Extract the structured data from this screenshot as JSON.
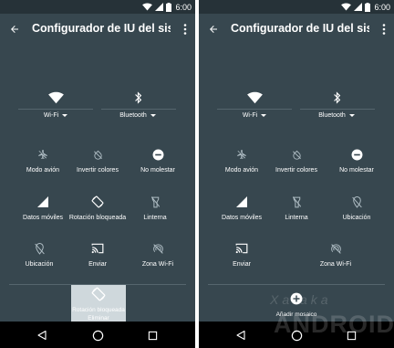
{
  "colors": {
    "background": "#37474f",
    "statusbar": "#263238",
    "navbar": "#000000",
    "text": "#ffffff",
    "drag_tile": "#cfd8dc"
  },
  "status": {
    "time": "6:00"
  },
  "left": {
    "title": "Configurador de IU del sist...",
    "top_tiles": [
      {
        "label": "Wi-Fi",
        "icon": "wifi-icon"
      },
      {
        "label": "Bluetooth",
        "icon": "bluetooth-icon"
      }
    ],
    "tiles": [
      {
        "label": "Modo avión",
        "icon": "airplane-off-icon"
      },
      {
        "label": "Invertir colores",
        "icon": "invert-colors-icon"
      },
      {
        "label": "No molestar",
        "icon": "do-not-disturb-icon"
      },
      {
        "label": "Datos móviles",
        "icon": "cellular-signal-icon"
      },
      {
        "label": "Rotación bloqueada",
        "icon": "screen-rotation-icon"
      },
      {
        "label": "Linterna",
        "icon": "flashlight-icon"
      },
      {
        "label": "Ubicación",
        "icon": "location-off-icon"
      },
      {
        "label": "Enviar",
        "icon": "cast-icon"
      },
      {
        "label": "Zona Wi-Fi",
        "icon": "hotspot-icon"
      }
    ],
    "dragging_tile": {
      "label": "Rotación bloqueada",
      "action": "Eliminar",
      "icon": "screen-rotation-icon"
    }
  },
  "right": {
    "title": "Configurador de IU del sist...",
    "top_tiles": [
      {
        "label": "Wi-Fi",
        "icon": "wifi-icon"
      },
      {
        "label": "Bluetooth",
        "icon": "bluetooth-icon"
      }
    ],
    "tiles": [
      {
        "label": "Modo avión",
        "icon": "airplane-off-icon"
      },
      {
        "label": "Invertir colores",
        "icon": "invert-colors-icon"
      },
      {
        "label": "No molestar",
        "icon": "do-not-disturb-icon"
      },
      {
        "label": "Datos móviles",
        "icon": "cellular-signal-icon"
      },
      {
        "label": "Linterna",
        "icon": "flashlight-icon"
      },
      {
        "label": "Ubicación",
        "icon": "location-off-icon"
      },
      {
        "label": "Enviar",
        "icon": "cast-icon"
      },
      {
        "label": "Zona Wi-Fi",
        "icon": "hotspot-icon"
      }
    ],
    "add_button": {
      "label": "Añadir mosaico",
      "icon": "add-circle-icon"
    }
  },
  "watermark": {
    "line1": "Xataka",
    "line2": "ANDROID"
  }
}
